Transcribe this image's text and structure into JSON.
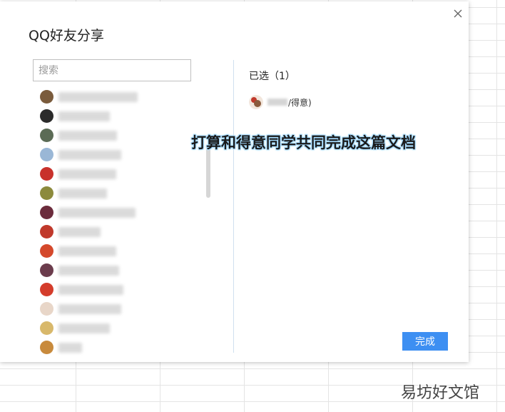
{
  "dialog": {
    "title": "QQ好友分享",
    "close_icon": "close-icon",
    "search_placeholder": "搜索",
    "done_label": "完成"
  },
  "selected": {
    "header": "已选（1）",
    "item_suffix": "/得意)"
  },
  "caption": "打算和得意同学共同完成这篇文档",
  "watermark": "易坊好文馆",
  "colors": {
    "accent": "#3d8ff2",
    "divider": "#cfe0ef",
    "caption_glow": "#9fd8ff"
  },
  "friends": [
    {
      "avatar": "#7a5b3c",
      "name_w": 0.85
    },
    {
      "avatar": "#2b2b2b",
      "name_w": 0.55
    },
    {
      "avatar": "#5b6b55",
      "name_w": 0.63
    },
    {
      "avatar": "#9ab7d6",
      "name_w": 0.68
    },
    {
      "avatar": "#c8312b",
      "name_w": 0.62
    },
    {
      "avatar": "#8c8a3c",
      "name_w": 0.52
    },
    {
      "avatar": "#6b2b3c",
      "name_w": 0.83
    },
    {
      "avatar": "#c0392b",
      "name_w": 0.45
    },
    {
      "avatar": "#d4482b",
      "name_w": 0.62
    },
    {
      "avatar": "#6b3c4c",
      "name_w": 0.65
    },
    {
      "avatar": "#d43c2b",
      "name_w": 0.7
    },
    {
      "avatar": "#e8d6c8",
      "name_w": 0.68
    },
    {
      "avatar": "#d8b86b",
      "name_w": 0.55
    },
    {
      "avatar": "#c88a3c",
      "name_w": 0.25
    }
  ]
}
